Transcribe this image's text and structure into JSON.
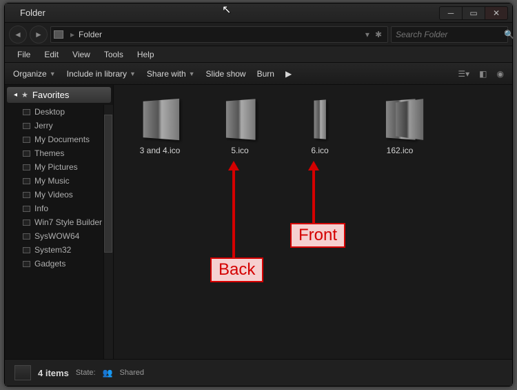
{
  "window": {
    "title": "Folder"
  },
  "nav": {
    "crumb_icon": "▸",
    "folder_label": "Folder",
    "search_placeholder": "Search Folder"
  },
  "menu": {
    "file": "File",
    "edit": "Edit",
    "view": "View",
    "tools": "Tools",
    "help": "Help"
  },
  "toolbar": {
    "organize": "Organize",
    "include": "Include in library",
    "share": "Share with",
    "slideshow": "Slide show",
    "burn": "Burn"
  },
  "sidebar": {
    "header": "Favorites",
    "items": [
      "Desktop",
      "Jerry",
      "My Documents",
      "Themes",
      "My Pictures",
      "My Music",
      "My Videos",
      "Info",
      "Win7 Style Builder",
      "SysWOW64",
      "System32",
      "Gadgets"
    ]
  },
  "files": [
    {
      "name": "3 and 4.ico",
      "variant": "thick"
    },
    {
      "name": "5.ico",
      "variant": ""
    },
    {
      "name": "6.ico",
      "variant": "thin"
    },
    {
      "name": "162.ico",
      "variant": "multi"
    }
  ],
  "status": {
    "count": "4 items",
    "state_label": "State:",
    "state_value": "Shared"
  },
  "annotations": {
    "back": "Back",
    "front": "Front"
  }
}
